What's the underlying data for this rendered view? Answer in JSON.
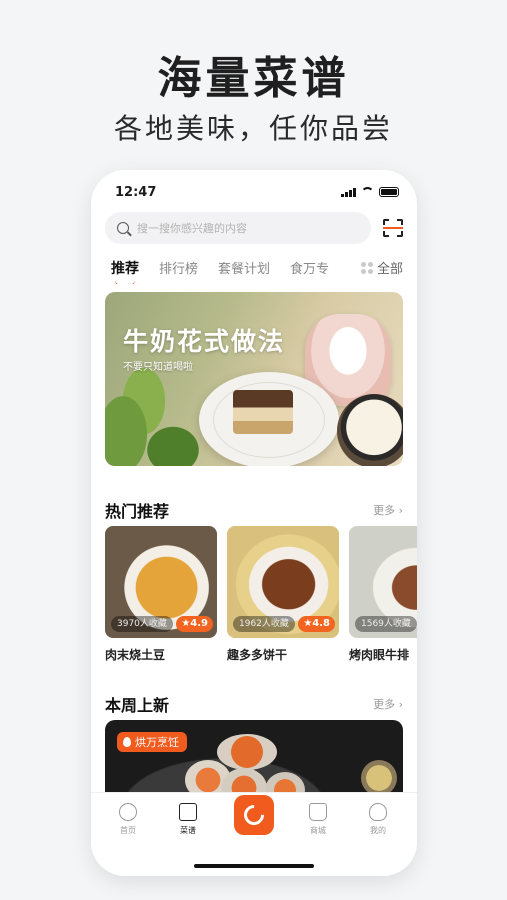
{
  "promo": {
    "headline": "海量菜谱",
    "subline": "各地美味，任你品尝"
  },
  "status": {
    "time": "12:47"
  },
  "search": {
    "placeholder": "搜一搜你感兴趣的内容",
    "icon": "search-icon",
    "scan_icon": "scan-icon"
  },
  "tabs": [
    {
      "label": "推荐",
      "active": true
    },
    {
      "label": "排行榜",
      "active": false
    },
    {
      "label": "套餐计划",
      "active": false
    },
    {
      "label": "食万专",
      "active": false
    }
  ],
  "tab_all": {
    "label": "全部",
    "icon": "grid-icon"
  },
  "banner": {
    "title": "牛奶花式做法",
    "subtitle": "不要只知道喝啦"
  },
  "hot": {
    "title": "热门推荐",
    "more": "更多",
    "items": [
      {
        "name": "肉末烧土豆",
        "saves": "3970人收藏",
        "rating": "4.9"
      },
      {
        "name": "趣多多饼干",
        "saves": "1962人收藏",
        "rating": "4.8"
      },
      {
        "name": "烤肉眼牛排",
        "saves": "1569人收藏",
        "rating": ""
      }
    ]
  },
  "weekly": {
    "title": "本周上新",
    "more": "更多",
    "badge": "烘万烹饪"
  },
  "tabbar": {
    "items": [
      {
        "label": "首页",
        "icon": "home-icon"
      },
      {
        "label": "菜谱",
        "icon": "recipe-book-icon"
      },
      {
        "label": "",
        "icon": "center-logo-icon"
      },
      {
        "label": "商城",
        "icon": "shop-bag-icon"
      },
      {
        "label": "我的",
        "icon": "profile-icon"
      }
    ]
  },
  "colors": {
    "accent": "#f25b1e",
    "background": "#f4f5f7"
  }
}
